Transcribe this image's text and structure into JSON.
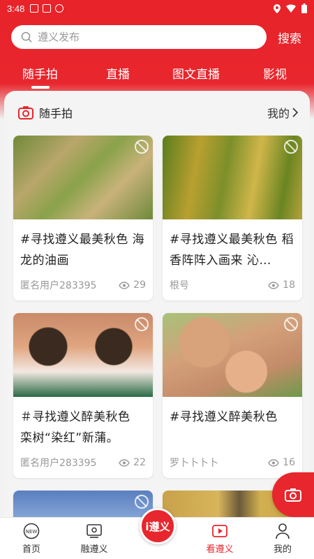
{
  "status": {
    "time": "3:48"
  },
  "search": {
    "placeholder": "遵义发布",
    "button": "搜索"
  },
  "tabs": [
    {
      "label": "随手拍",
      "active": true
    },
    {
      "label": "直播"
    },
    {
      "label": "图文直播"
    },
    {
      "label": "影视"
    }
  ],
  "section": {
    "title": "随手拍",
    "mine": "我的"
  },
  "cards": [
    {
      "title": "#寻找遵义最美秋色 海龙的油画",
      "author": "匿名用户283395",
      "views": "29"
    },
    {
      "title": "#寻找遵义最美秋色 稻香阵阵入画来 沁…",
      "author": "根号",
      "views": "18"
    },
    {
      "title": "＃寻找遵义醉美秋色 栾树“染红”新蒲。",
      "author": "匿名用户283395",
      "views": "22"
    },
    {
      "title": "#寻找遵义醉美秋色",
      "author": "罗卜卜卜卜",
      "views": "16"
    }
  ],
  "nav": {
    "home": "首页",
    "rong": "融遵义",
    "center": "i遵义",
    "kan": "看遵义",
    "mine": "我的"
  },
  "colors": {
    "brand": "#e8262d"
  }
}
